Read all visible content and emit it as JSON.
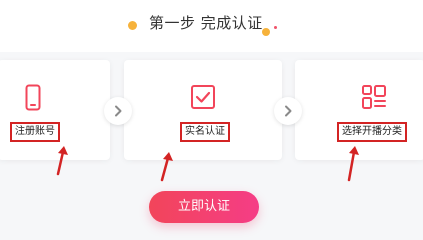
{
  "header": {
    "title": "第一步 完成认证"
  },
  "steps": [
    {
      "label": "注册账号",
      "icon": "phone-icon"
    },
    {
      "label": "实名认证",
      "icon": "checkbox-check-icon"
    },
    {
      "label": "选择开播分类",
      "icon": "category-grid-icon"
    }
  ],
  "cta": {
    "label": "立即认证"
  },
  "colors": {
    "accent": "#f2455a",
    "accent_end": "#f53d86",
    "annotation_red": "#d32424",
    "dot_orange": "#f6b23b"
  },
  "icons": {
    "arrow": "chevron-right-icon"
  }
}
